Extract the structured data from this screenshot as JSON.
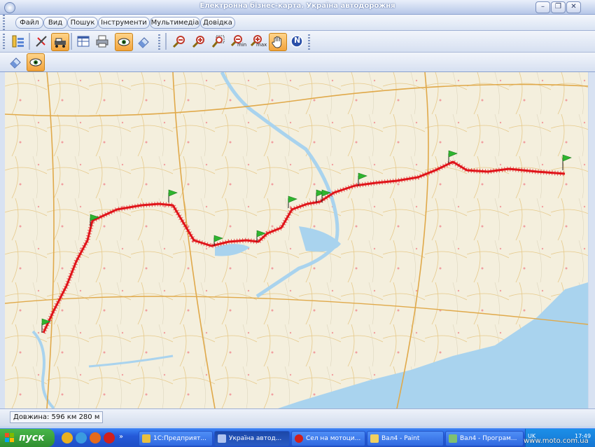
{
  "window": {
    "title": "Електронна бізнес-карта. Україна автодорожня"
  },
  "menu": {
    "items": [
      "Файл",
      "Вид",
      "Пошук",
      "Інструменти",
      "Мультимедіа",
      "Довідка"
    ]
  },
  "toolbar": {
    "icons": [
      "layers-icon",
      "route-ruler-icon",
      "route-tool-icon",
      "table-icon",
      "print-icon",
      "view-eye-icon",
      "eraser-icon",
      "zoom-out-icon",
      "zoom-in-icon",
      "zoom-rect-icon",
      "zoom-min-icon",
      "zoom-max-icon",
      "pan-hand-icon",
      "north-icon"
    ],
    "zoom_min_label": "min",
    "zoom_max_label": "max",
    "north_label": "N"
  },
  "toolbar2": {
    "icons": [
      "eraser-icon",
      "view-eye-icon"
    ]
  },
  "map": {
    "route_color": "#e0141a",
    "water_color": "#a9d3ee",
    "land_color": "#f4efdd",
    "waypoint_flag_color": "#2fb52f"
  },
  "status": {
    "length_text": "Довжина: 596 км 280 м"
  },
  "taskbar": {
    "start_label": "пуск",
    "tasks": [
      {
        "label": "1С:Предприят..."
      },
      {
        "label": "Україна автод..."
      },
      {
        "label": "Сел на мотоци..."
      },
      {
        "label": "Вал4 - Paint"
      },
      {
        "label": "Вал4 - Програм..."
      }
    ],
    "tray_lang": "UK",
    "tray_clock": "17:49"
  },
  "watermark": "www.moto.com.ua"
}
